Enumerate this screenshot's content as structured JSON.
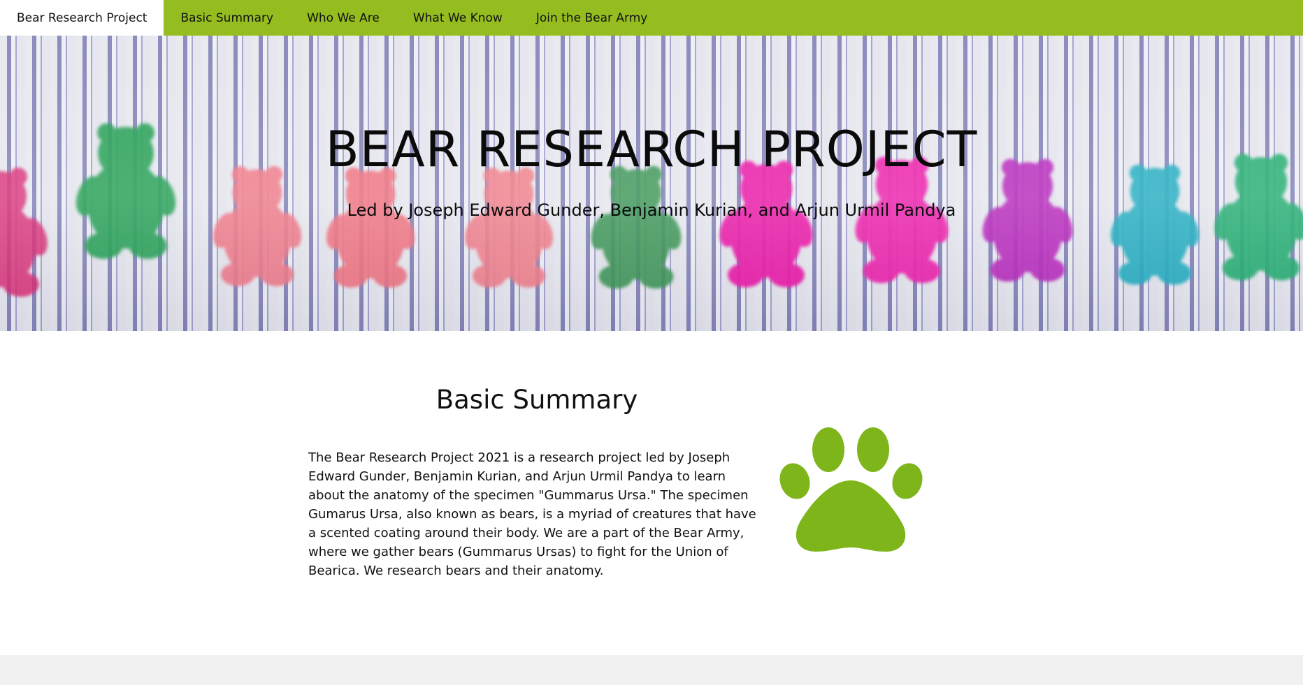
{
  "nav": {
    "items": [
      {
        "label": "Bear Research Project",
        "active": true
      },
      {
        "label": "Basic Summary",
        "active": false
      },
      {
        "label": "Who We Are",
        "active": false
      },
      {
        "label": "What We Know",
        "active": false
      },
      {
        "label": "Join the Bear Army",
        "active": false
      }
    ]
  },
  "hero": {
    "title": "BEAR RESEARCH PROJECT",
    "subtitle": "Led by Joseph Edward Gunder, Benjamin Kurian, and Arjun Urmil Pandya",
    "image_subject": "row of colored gummy bears on striped cloth"
  },
  "summary": {
    "heading": "Basic Summary",
    "body": "The Bear Research Project 2021 is a research project led by Joseph Edward Gunder, Benjamin Kurian, and Arjun Urmil Pandya to learn about the anatomy of the specimen \"Gummarus Ursa.\" The specimen Gumarus Ursa, also known as bears, is a myriad of creatures that have a scented coating around their body. We are a part of the Bear Army, where we gather bears (Gummarus Ursas) to fight for the Union of Bearica. We research bears and their anatomy.",
    "icon": "paw-icon"
  },
  "colors": {
    "nav_bg": "#95bd1f",
    "paw": "#7db51a",
    "footer_bg": "#f1f1f1"
  }
}
